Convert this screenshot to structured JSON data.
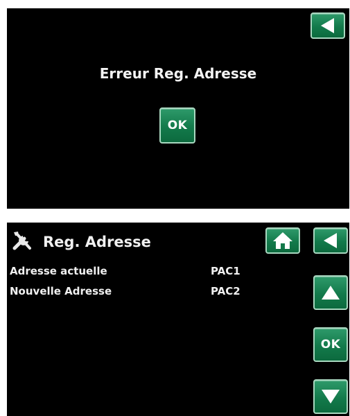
{
  "error_dialog": {
    "message": "Erreur Reg. Adresse",
    "ok_label": "OK"
  },
  "reg_adresse": {
    "title": "Reg. Adresse",
    "header_icon": "tools-icon",
    "rows": [
      {
        "label": "Adresse actuelle",
        "value": "PAC1"
      },
      {
        "label": "Nouvelle Adresse",
        "value": "PAC2"
      }
    ],
    "ok_label": "OK"
  },
  "colors": {
    "background": "#000000",
    "button_green": "#137a4b",
    "button_border": "#a9d8c0",
    "text": "#f0f0f0"
  }
}
